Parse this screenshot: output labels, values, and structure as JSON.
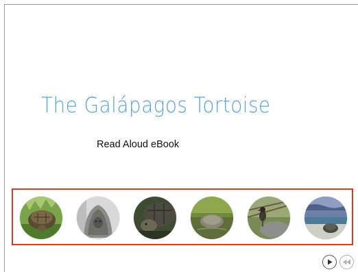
{
  "slide": {
    "title": "The Galápagos Tortoise",
    "subtitle": "Read Aloud eBook"
  },
  "gallery": {
    "border_color": "#d93a2b",
    "thumbnails": [
      {
        "icon": "tortoise-grass-photo-icon"
      },
      {
        "icon": "tortoise-portrait-photo-icon"
      },
      {
        "icon": "tortoise-closeup-photo-icon"
      },
      {
        "icon": "tortoise-pond-photo-icon"
      },
      {
        "icon": "finch-on-tortoise-photo-icon"
      },
      {
        "icon": "tortoise-beach-photo-icon"
      }
    ]
  },
  "navigation": {
    "play_icon": "play-icon",
    "rewind_icon": "rewind-icon"
  },
  "colors": {
    "title": "#57a3dc",
    "subtitle": "#111111"
  }
}
